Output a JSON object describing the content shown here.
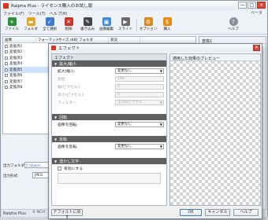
{
  "window": {
    "title": "Ralpha Plus - ライセンス購入のお試し版",
    "minimize": "—",
    "maximize": "□",
    "close": "×"
  },
  "menu": {
    "items": [
      "ファイル(F)",
      "ツール(T)",
      "ヘルプ(H)"
    ],
    "beta": "ベータ"
  },
  "toolbar": {
    "buttons": [
      {
        "label": "ファイル",
        "icon": "add-file-icon",
        "color": "#2f8f3a"
      },
      {
        "label": "フォルダ",
        "icon": "add-folder-icon",
        "color": "#e0a62a"
      },
      {
        "label": "全て選択",
        "icon": "select-all-icon",
        "color": "#3b7bd0"
      },
      {
        "label": "削除",
        "icon": "delete-icon",
        "color": "#c8382c"
      },
      {
        "label": "書き込み",
        "icon": "write-icon",
        "color": "#444444"
      },
      {
        "label": "画像編集",
        "icon": "image-edit-icon",
        "color": "#3e8ad8"
      },
      {
        "label": "スライド",
        "icon": "slide-icon",
        "color": "#6a6a6a"
      },
      {
        "label": "オプション",
        "icon": "options-icon",
        "color": "#d88a1a"
      },
      {
        "label": "購入",
        "icon": "cart-icon",
        "color": "#e68a1a"
      },
      {
        "label": "ヘルプ",
        "icon": "help-icon",
        "color": "#8a8fa0"
      }
    ]
  },
  "filelist": {
    "columns": [
      "画像",
      "フォーマット",
      "サイズ (KB)",
      "フォルダ",
      "状況"
    ],
    "rows": [
      "変換済1",
      "変換済2",
      "変換済3",
      "変換済4",
      "変換済5",
      "変換済6",
      "変換済7",
      "変換済8"
    ],
    "selected_index": 4
  },
  "preview": {
    "title": "変換1"
  },
  "output": {
    "folder_label": "出力フォルダ:",
    "folder_value": "C:\\Users\\...",
    "format_label": "出力形式:",
    "format_value": "JPEG"
  },
  "status": {
    "app_name": "Ralpha Plus",
    "copyright": "© NCH"
  },
  "dialog": {
    "title": "エフェクト",
    "panel_header": "エフェクト",
    "preview_header": "適用した効果のプレビュー",
    "sections": {
      "scale": {
        "title": "拡大/縮小",
        "scale_label": "拡大/縮小:",
        "scale_value": "変更なし",
        "percent_label": "割合:",
        "percent_value": "100",
        "width_label": "幅(ピクセル):",
        "width_value": "0",
        "height_label": "高さ(ピクセル):",
        "height_value": "0",
        "filter_label": "フィルター:",
        "filter_value": "正方形ピクセル"
      },
      "rotate": {
        "title": "回転",
        "label": "画像を回転:",
        "value": "変更なし"
      },
      "flip": {
        "title": "反転",
        "label": "画像を反転:",
        "value": "変更なし"
      },
      "text": {
        "title": "透かし文字",
        "enable_label": "有効にする"
      }
    },
    "buttons": {
      "defaults": "デフォルトに戻す",
      "ok": "OK",
      "cancel": "キャンセル",
      "help": "ヘルプ"
    }
  }
}
